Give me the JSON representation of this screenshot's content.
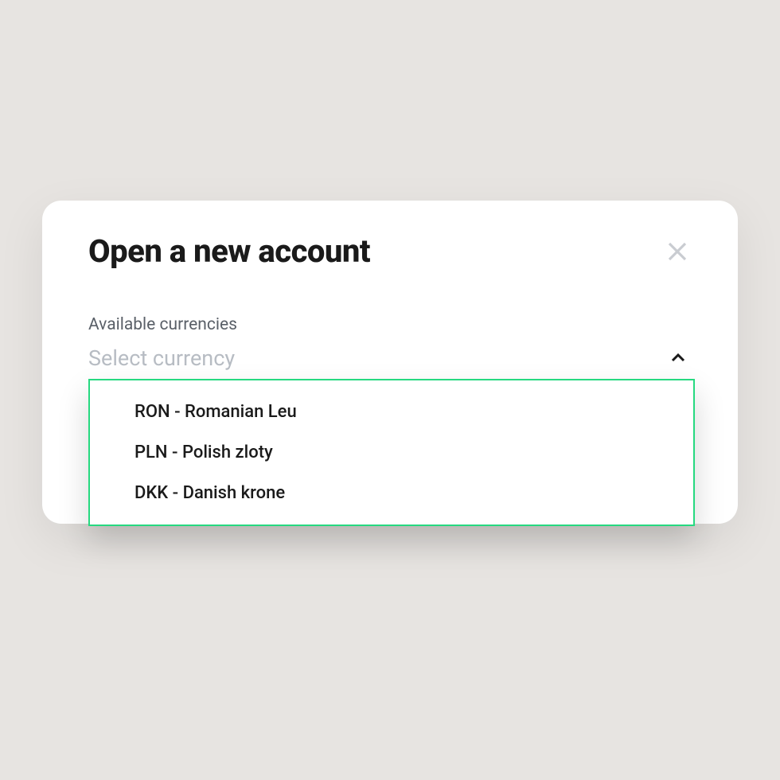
{
  "modal": {
    "title": "Open a new account",
    "field_label": "Available currencies",
    "select_placeholder": "Select currency",
    "options": [
      {
        "label": "RON - Romanian Leu"
      },
      {
        "label": "PLN - Polish zloty"
      },
      {
        "label": "DKK - Danish krone"
      }
    ]
  },
  "colors": {
    "accent": "#26d980",
    "background": "#e7e4e1",
    "text_primary": "#1a1a1a",
    "text_secondary": "#5a6068",
    "placeholder": "#b7bcc3"
  }
}
